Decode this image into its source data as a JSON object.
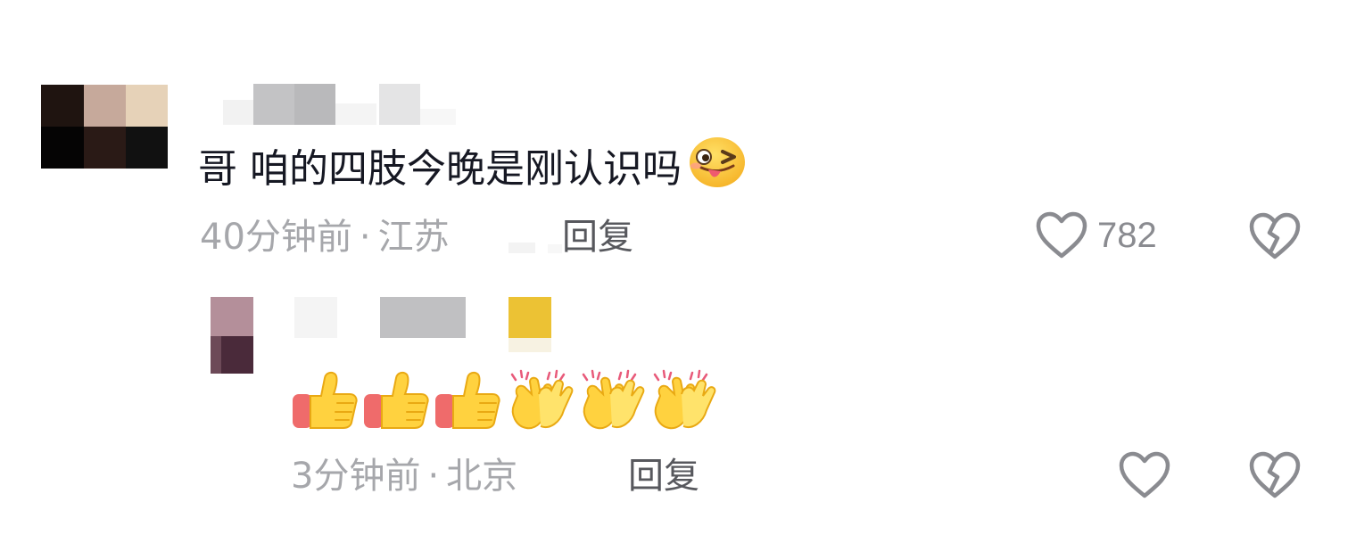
{
  "comment": {
    "author": "",
    "text": "哥 咱的四肢今晚是刚认识吗",
    "emoji": "wink-tongue-emoji",
    "time": "40分钟前",
    "separator": "·",
    "location": "江苏",
    "reply_label": "回复",
    "like_count": "782",
    "like_icon": "heart-outline-icon",
    "dislike_icon": "broken-heart-icon"
  },
  "reply": {
    "author": "",
    "emojis": [
      "thumbs-up",
      "thumbs-up",
      "thumbs-up",
      "clapping-hands",
      "clapping-hands",
      "clapping-hands"
    ],
    "time": "3分钟前",
    "separator": "·",
    "location": "北京",
    "reply_label": "回复",
    "like_icon": "heart-outline-icon",
    "dislike_icon": "broken-heart-icon"
  },
  "colors": {
    "text_primary": "#161823",
    "text_secondary": "#a6a7ab",
    "reply_text": "#57585d",
    "icon": "#8a8b90"
  }
}
